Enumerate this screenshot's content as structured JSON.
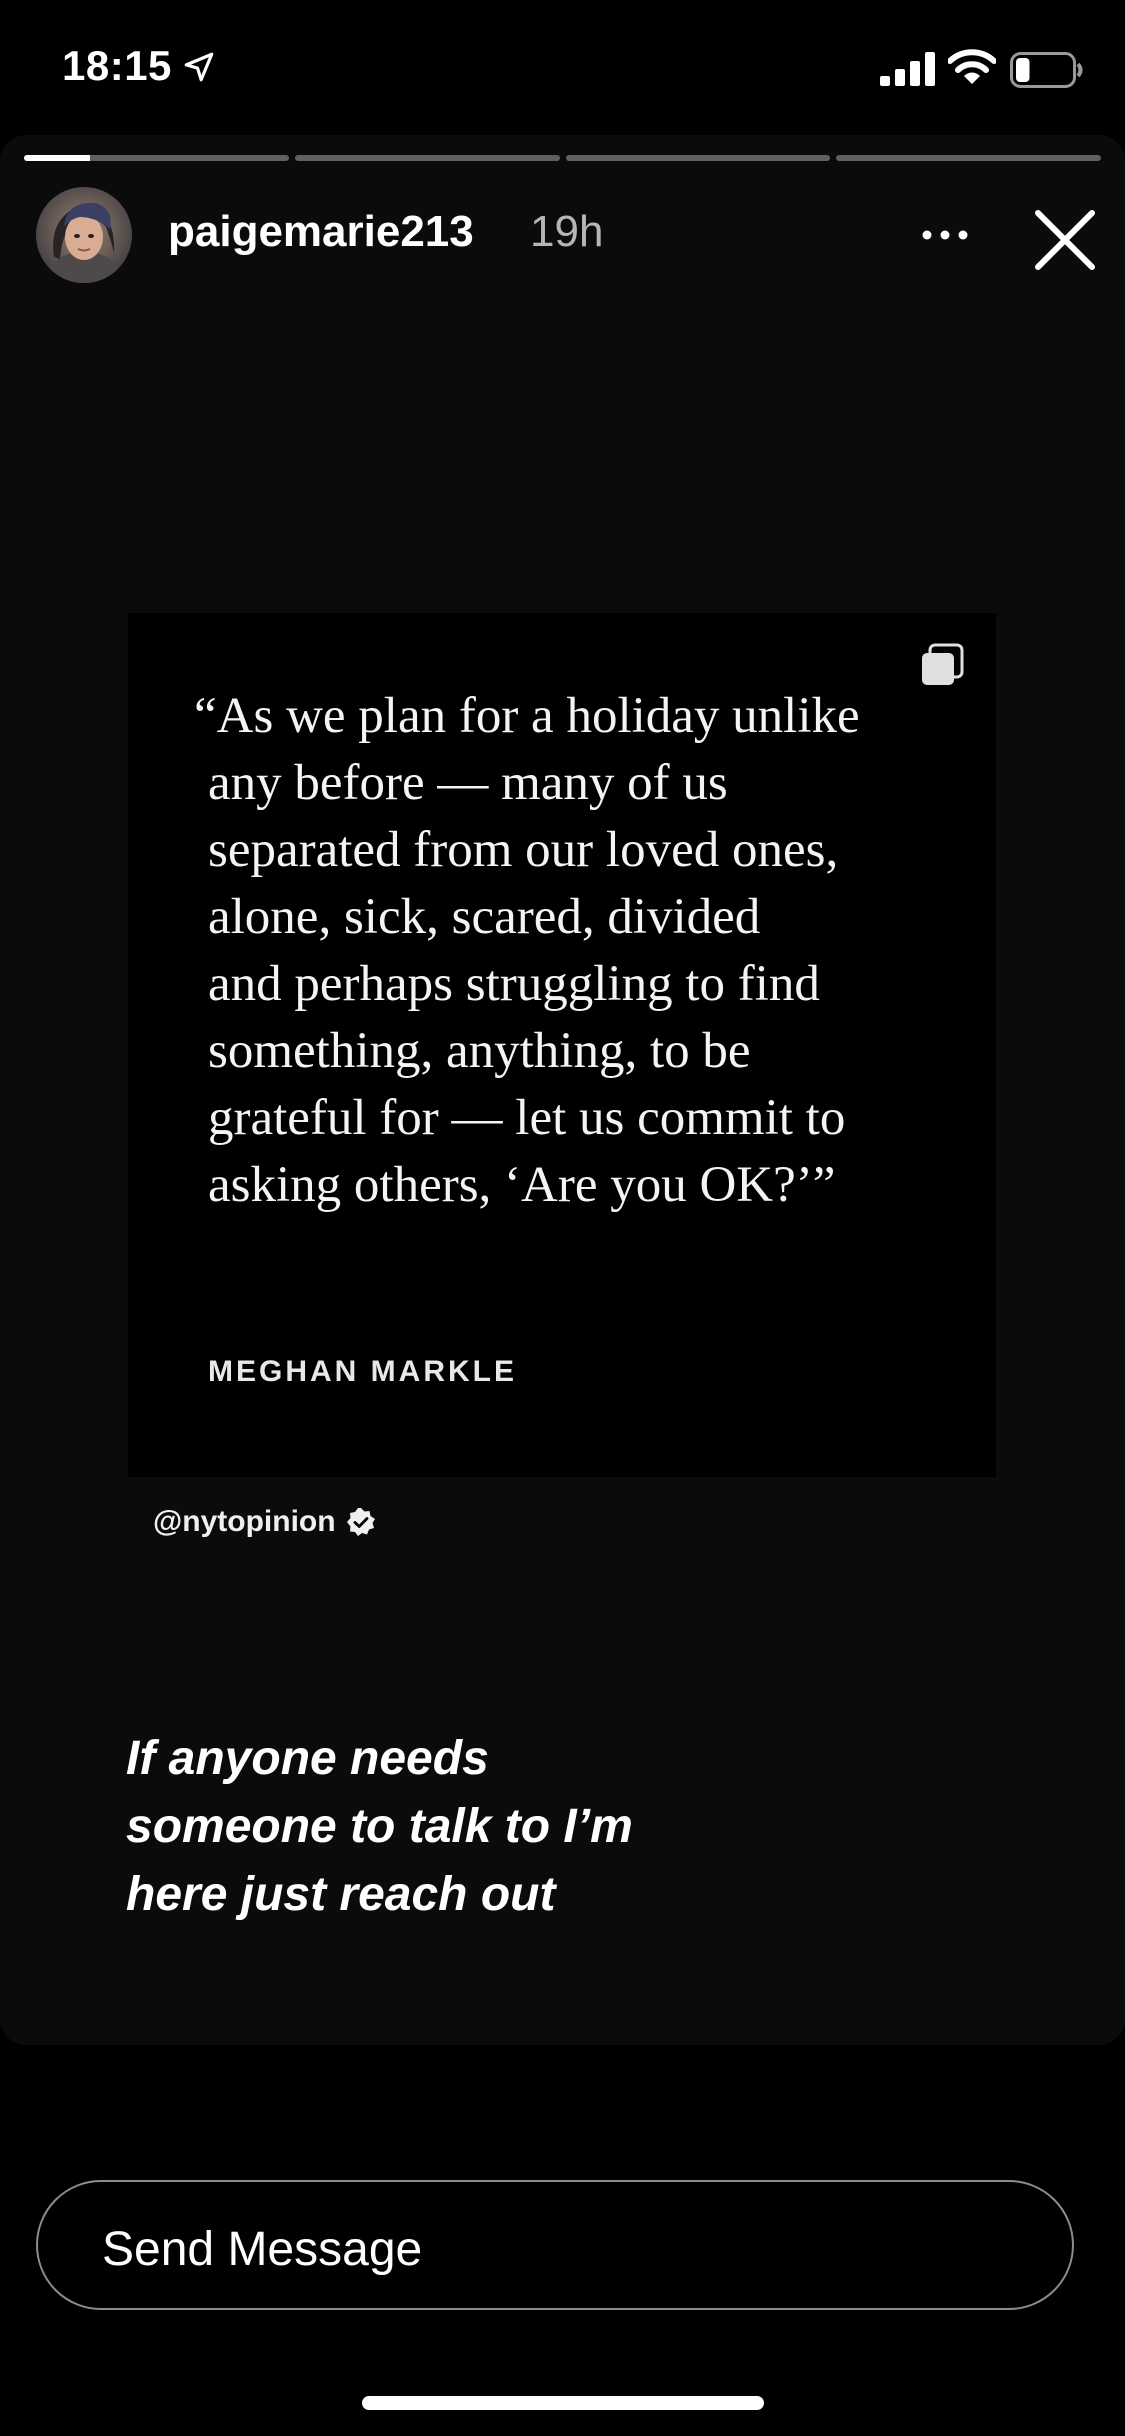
{
  "status_bar": {
    "time": "18:15",
    "battery_level": 0.25
  },
  "story": {
    "segments": [
      {
        "progress": 0.25
      },
      {
        "progress": 0
      },
      {
        "progress": 0
      },
      {
        "progress": 0
      }
    ],
    "username": "paigemarie213",
    "time_ago": "19h",
    "quote": {
      "lines": [
        "“As we plan for a holiday unlike",
        "any before — many of us",
        "separated from our loved ones,",
        "alone, sick, scared, divided",
        "and perhaps struggling to find",
        "something, anything, to be",
        "grateful for — let us commit to",
        "asking others, ‘Are you OK?’”"
      ],
      "author": "MEGHAN MARKLE"
    },
    "handle": "@nytopinion",
    "caption_lines": [
      "If anyone needs",
      "someone to talk to I’m",
      "here just reach out"
    ]
  },
  "reply": {
    "placeholder": "Send Message"
  },
  "icons": {
    "location": "location-arrow-icon",
    "signal": "cellular-signal-icon",
    "wifi": "wifi-icon",
    "battery": "battery-icon",
    "more": "more-dots-icon",
    "close": "close-icon",
    "stack": "multiple-posts-icon",
    "verified": "verified-badge-icon"
  },
  "colors": {
    "background": "#000000",
    "panel": "#0b0b0b",
    "text": "#ffffff"
  }
}
